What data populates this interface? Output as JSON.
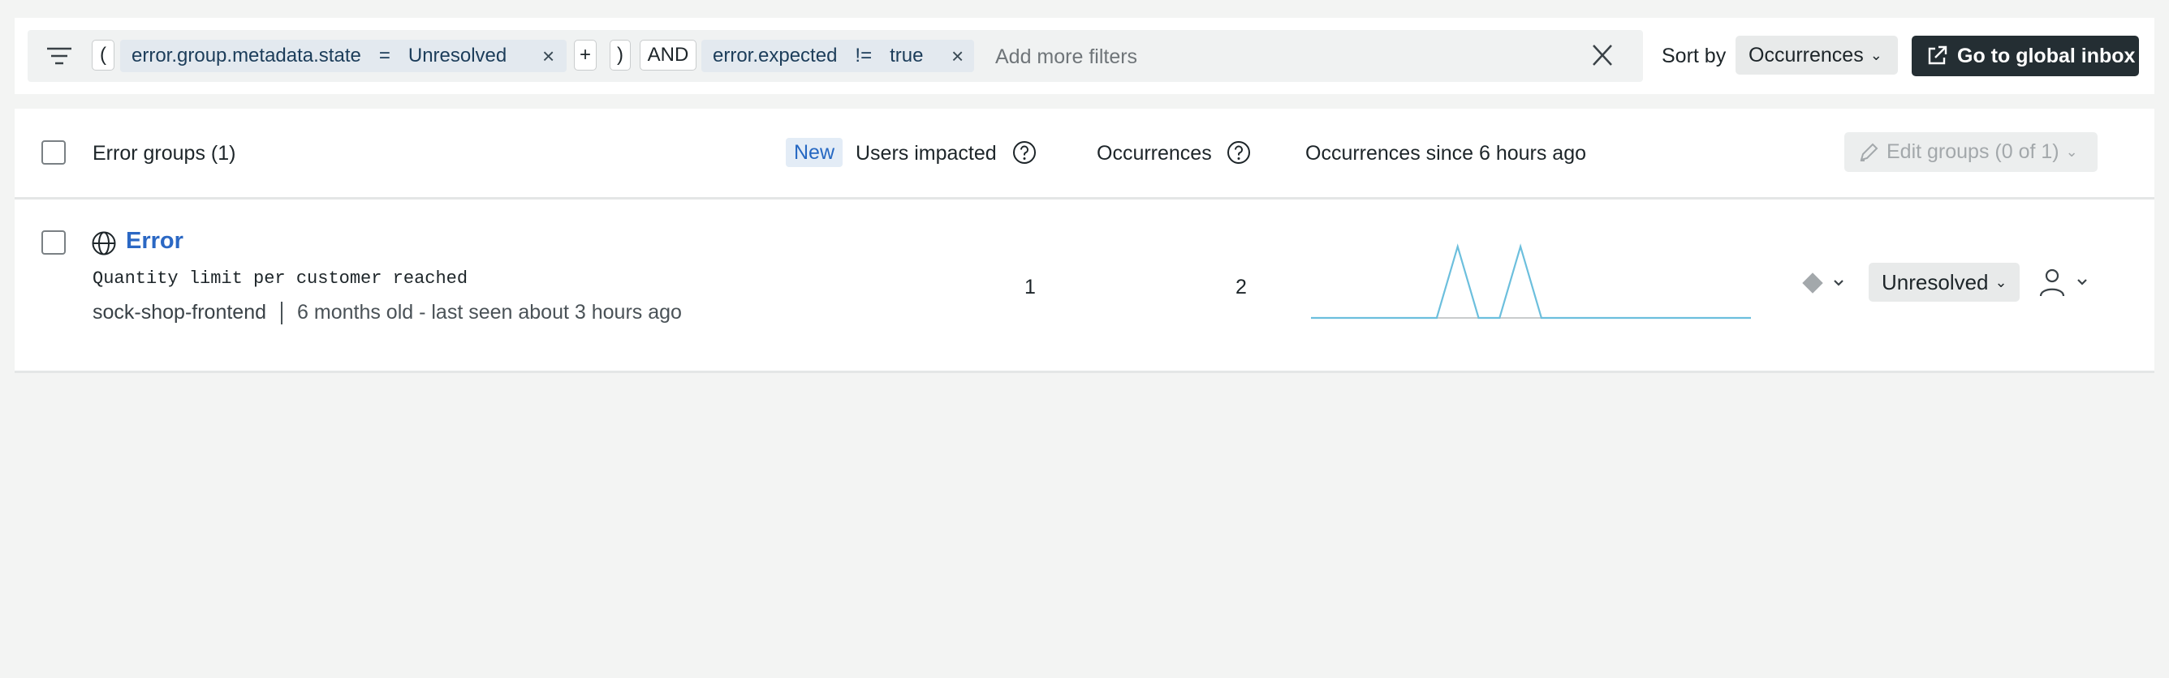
{
  "filter": {
    "open_paren": "(",
    "close_paren": ")",
    "chip1": {
      "field": "error.group.metadata.state",
      "operator": "=",
      "value": "Unresolved",
      "remove": "×"
    },
    "plus": "+",
    "connector": "AND",
    "chip2": {
      "field": "error.expected",
      "operator": "!=",
      "value": "true",
      "remove": "×"
    },
    "placeholder": "Add more filters"
  },
  "sort": {
    "label": "Sort by",
    "value": "Occurrences"
  },
  "global_inbox_label": "Go to global inbox",
  "table": {
    "header": {
      "title": "Error groups (1)",
      "new_badge": "New",
      "users_impacted": "Users impacted",
      "occurrences": "Occurrences",
      "occurrences_since": "Occurrences since 6 hours ago",
      "edit_groups": "Edit groups (0 of 1)"
    },
    "rows": [
      {
        "title": "Error",
        "message": "Quantity limit per customer reached",
        "service": "sock-shop-frontend",
        "age": "6 months old - last seen about 3 hours ago",
        "users_impacted": "1",
        "occurrences": "2",
        "sparkline": [
          0,
          0,
          0,
          0,
          0,
          0,
          0,
          1,
          0,
          0,
          1,
          0,
          0,
          0,
          0,
          0,
          0,
          0,
          0,
          0,
          0,
          0
        ],
        "status": "Unresolved"
      }
    ]
  },
  "colors": {
    "link": "#2b68c4",
    "spark_line": "#6cbfdd",
    "primary_button": "#242e33"
  }
}
